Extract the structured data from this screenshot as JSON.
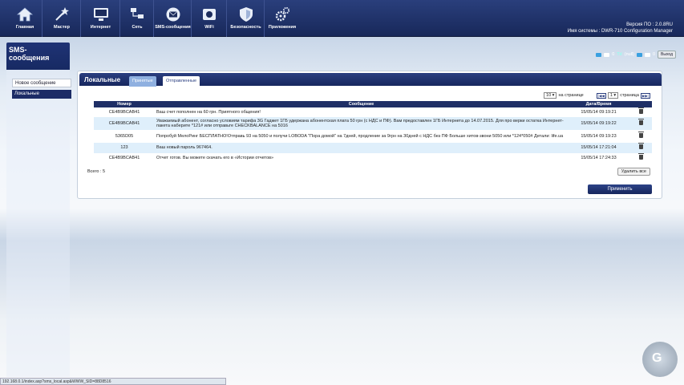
{
  "nav": [
    {
      "label": "Главная",
      "icon": "home-icon"
    },
    {
      "label": "Мастер",
      "icon": "wand-icon"
    },
    {
      "label": "Интернет",
      "icon": "monitor-icon"
    },
    {
      "label": "Сеть",
      "icon": "network-icon"
    },
    {
      "label": "SMS-сообщения",
      "icon": "envelope-icon"
    },
    {
      "label": "WiFi",
      "icon": "wifi-icon"
    },
    {
      "label": "Безопасность",
      "icon": "shield-icon"
    },
    {
      "label": "Приложения",
      "icon": "gears-icon"
    }
  ],
  "version": {
    "line1": "Версия ПО : 2.0.8RU",
    "line2": "Имя системы : DWR-710 Configuration Manager"
  },
  "sidebar": {
    "title": "SMS-\nсообщения",
    "items": [
      {
        "label": "Новое сообщение"
      },
      {
        "label": "Локальные"
      }
    ]
  },
  "status": {
    "signal_text": "(null)",
    "sms_count": "0",
    "user_count": "0",
    "logout": "Выход"
  },
  "panel": {
    "title": "Локальные",
    "tabs": [
      {
        "label": "Принятые"
      },
      {
        "label": "Отправленные"
      }
    ]
  },
  "pager": {
    "per_page": "10",
    "per_page_label": "на странице",
    "page": "1",
    "page_label": "страница"
  },
  "table": {
    "headers": [
      "Номер",
      "Сообщение",
      "Дата/Время",
      ""
    ],
    "rows": [
      {
        "number": "CE4B9BCAB41",
        "message": "Ваш счет пополнен на 60 грн. Приятного общения!",
        "datetime": "15/05/14 09:19:21"
      },
      {
        "number": "CE4B9BCAB41",
        "message": "Уважаемый абонент, согласно условиям тарифа 3G Гаджет 1ГБ удержана абонентская плата 50 грн (с НДС и ПФ). Вам предоставлен 1ГБ Интернета до 14.07.2015. Для про верки остатка Интернет-пакета наберите *121# или отправьте CHECKBALANCE на 5016",
        "datetime": "15/05/14 09:19:22"
      },
      {
        "number": "5365D05",
        "message": "Попробуй МелоРинг БЕСПЛАТНО!Отправь 93 на 5050 и получи LOBODA \"Пора домой\" на 7дней, продление за 9грн на 30дней с НДС без ПФ Больше хитов-звони 5050 или *124*050# Детали: life.ua",
        "datetime": "15/05/14 09:19:23"
      },
      {
        "number": "123",
        "message": "Ваш новый пароль 967464.",
        "datetime": "15/05/14 17:21:04"
      },
      {
        "number": "CE4B9BCAB41",
        "message": "Отчет готов. Вы можете скачать его в «Истории отчетов»",
        "datetime": "15/05/14 17:24:33"
      }
    ]
  },
  "total": "Всего : 5",
  "delete_all": "Удалить все",
  "apply": "Применить",
  "statusbar_url": "192.168.0.1/index.asp?sms_local.asp&WWW_SID=88D8516",
  "logo_text": "G"
}
